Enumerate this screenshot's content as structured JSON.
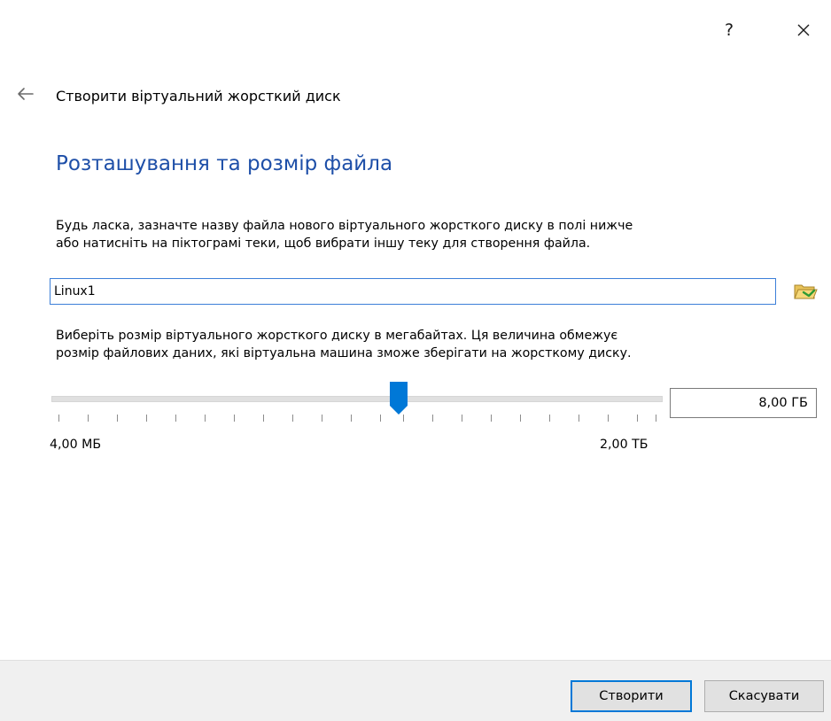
{
  "window": {
    "help_label": "?",
    "close_icon": "close-icon",
    "back_icon": "back-arrow-icon"
  },
  "wizard": {
    "title": "Створити віртуальний жорсткий диск",
    "heading": "Розташування та розмір файла",
    "heading_color": "#1e4fa8"
  },
  "file_location": {
    "description_line1": "Будь ласка, зазначте назву файла нового віртуального жорсткого диску в полі нижче",
    "description_line2": "або натисніть на піктограмі теки, щоб вибрати іншу теку для створення файла.",
    "value": "Linux1",
    "folder_icon": "folder-icon"
  },
  "file_size": {
    "description_line1": "Виберіть розмір віртуального жорсткого диску в мегабайтах. Ця величина обмежує",
    "description_line2": "розмір файлових даних, які віртуальна машина зможе зберігати на жорсткому диску.",
    "value": "8,00 ГБ",
    "min_label": "4,00 МБ",
    "max_label": "2,00 ТБ",
    "slider_fraction": 0.57,
    "slider_color": "#0078d7"
  },
  "footer": {
    "create_label": "Створити",
    "cancel_label": "Скасувати",
    "accent_color": "#0078d7"
  }
}
